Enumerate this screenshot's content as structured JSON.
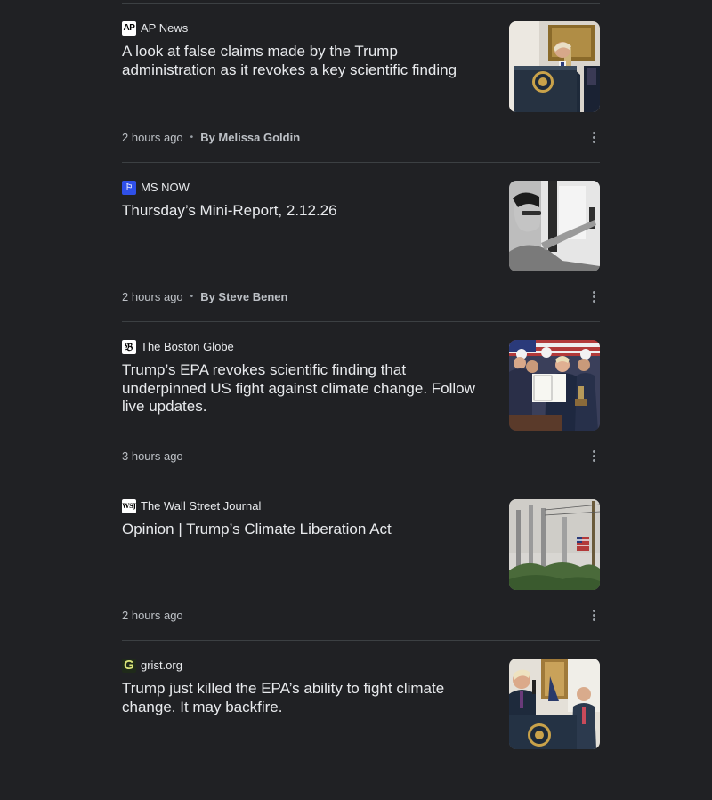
{
  "articles": [
    {
      "source": "AP News",
      "logo_text": "AP",
      "logo_icon": "ap-news-logo-icon",
      "headline": "A look at false claims made by the Trump administration as it revokes a key scientific finding",
      "time": "2 hours ago",
      "author": "By Melissa Goldin"
    },
    {
      "source": "MS NOW",
      "logo_text": "⚐",
      "logo_icon": "ms-now-logo-icon",
      "headline": "Thursday’s Mini-Report, 2.12.26",
      "time": "2 hours ago",
      "author": "By Steve Benen"
    },
    {
      "source": "The Boston Globe",
      "logo_text": "𝔅",
      "logo_icon": "boston-globe-logo-icon",
      "headline": "Trump’s EPA revokes scientific finding that underpinned US fight against climate change. Follow live updates.",
      "time": "3 hours ago",
      "author": ""
    },
    {
      "source": "The Wall Street Journal",
      "logo_text": "WSJ",
      "logo_icon": "wsj-logo-icon",
      "headline": "Opinion | Trump’s Climate Liberation Act",
      "time": "2 hours ago",
      "author": ""
    },
    {
      "source": "grist.org",
      "logo_text": "G",
      "logo_icon": "grist-logo-icon",
      "headline": "Trump just killed the EPA’s ability to fight climate change. It may backfire.",
      "time": "",
      "author": ""
    }
  ],
  "colors": {
    "background": "#202124",
    "divider": "#3c4043",
    "text_primary": "#e8eaed",
    "text_secondary": "#bdc1c6"
  }
}
